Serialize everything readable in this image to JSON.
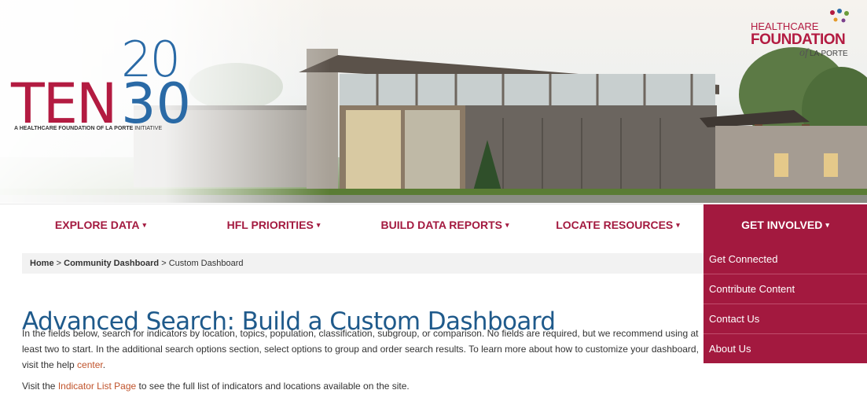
{
  "hero": {
    "logo_ten30": {
      "top_number": "20",
      "word": "TEN",
      "number": "30",
      "tagline_bold": "A HEALTHCARE FOUNDATION OF LA PORTE",
      "tagline_light": "INITIATIVE"
    },
    "logo_foundation": {
      "line1": "HEALTHCARE",
      "line2": "FOUNDATION",
      "line3_of": "of",
      "line3": "LA PORTE"
    }
  },
  "nav": {
    "items": [
      {
        "label": "EXPLORE DATA"
      },
      {
        "label": "HFL PRIORITIES"
      },
      {
        "label": "BUILD DATA REPORTS"
      },
      {
        "label": "LOCATE RESOURCES"
      },
      {
        "label": "GET INVOLVED"
      }
    ],
    "caret": "▾"
  },
  "dropdown": {
    "items": [
      {
        "label": "Get Connected"
      },
      {
        "label": "Contribute Content"
      },
      {
        "label": "Contact Us"
      },
      {
        "label": "About Us"
      }
    ]
  },
  "breadcrumb": {
    "home": "Home",
    "sep": ">",
    "dashboard": "Community Dashboard",
    "current": "Custom Dashboard"
  },
  "main": {
    "title": "Advanced Search: Build a Custom Dashboard",
    "paragraph_text": "In the fields below, search for indicators by location, topics, population, classification, subgroup, or comparison. No fields are required, but we recommend using at least two to start. In the additional search options section, select options to group and order search results. To learn more about how to customize your dashboard, visit the help ",
    "paragraph_link": "center",
    "paragraph_end": ".",
    "visit_prefix": "Visit the ",
    "visit_link": "Indicator List Page",
    "visit_suffix": " to see the full list of indicators and locations available on the site."
  },
  "colors": {
    "brand_red": "#a3193f",
    "brand_blue": "#1f5a8b",
    "link_orange": "#c0532b"
  }
}
